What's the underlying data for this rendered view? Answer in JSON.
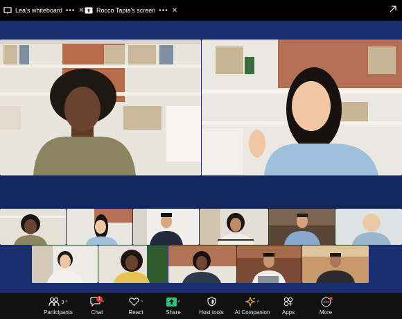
{
  "tabs": [
    {
      "label": "Lea’s whiteboard",
      "icon": "whiteboard-icon"
    },
    {
      "label": "Rocco Tapia’s screen",
      "icon": "screen-share-icon"
    }
  ],
  "toolbar": {
    "participants": {
      "label": "Participants",
      "count": "3",
      "icon": "participants-icon"
    },
    "chat": {
      "label": "Chat",
      "badge": "1",
      "icon": "chat-icon"
    },
    "react": {
      "label": "React",
      "icon": "heart-icon"
    },
    "share": {
      "label": "Share",
      "icon": "share-arrow-icon",
      "accent": "#2ec27e"
    },
    "host_tools": {
      "label": "Host tools",
      "icon": "shield-icon"
    },
    "ai_companion": {
      "label": "AI Companion",
      "icon": "sparkle-icon",
      "accent": "#e8a33a"
    },
    "apps": {
      "label": "Apps",
      "icon": "apps-icon"
    },
    "more": {
      "label": "More",
      "icon": "more-icon"
    }
  },
  "colors": {
    "stage": "#1a2f6f",
    "band": "#12275e",
    "bar": "#111111",
    "badge": "#e0343a"
  }
}
